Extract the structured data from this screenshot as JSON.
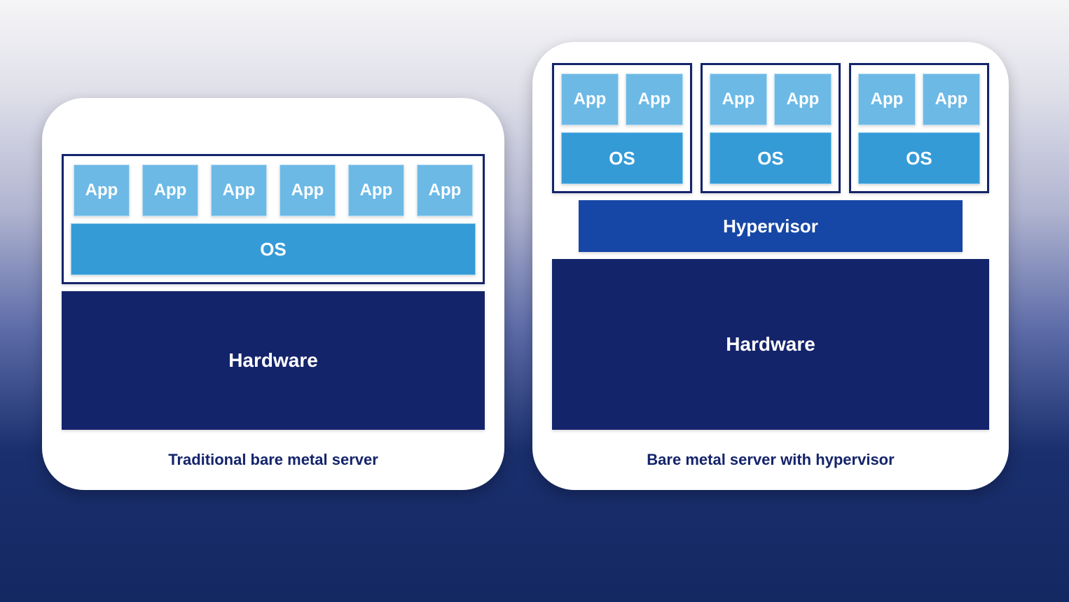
{
  "left": {
    "caption": "Traditional bare metal server",
    "apps": [
      "App",
      "App",
      "App",
      "App",
      "App",
      "App"
    ],
    "os": "OS",
    "hardware": "Hardware"
  },
  "right": {
    "caption": "Bare metal server with hypervisor",
    "vms": [
      {
        "apps": [
          "App",
          "App"
        ],
        "os": "OS"
      },
      {
        "apps": [
          "App",
          "App"
        ],
        "os": "OS"
      },
      {
        "apps": [
          "App",
          "App"
        ],
        "os": "OS"
      }
    ],
    "hypervisor": "Hypervisor",
    "hardware": "Hardware"
  }
}
